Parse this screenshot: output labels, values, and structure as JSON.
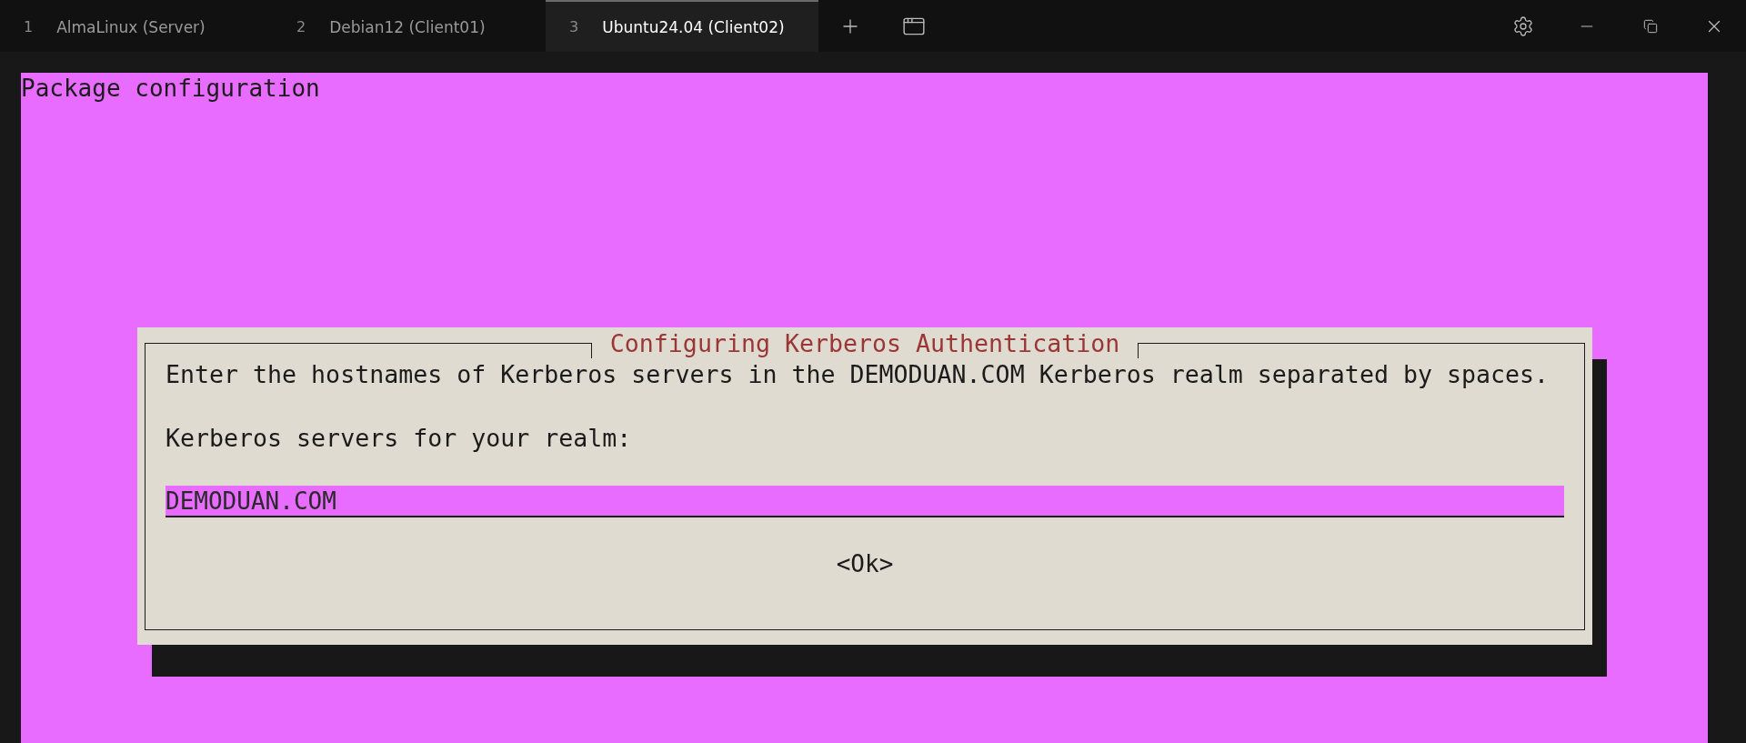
{
  "tabs": [
    {
      "number": "1",
      "label": "AlmaLinux (Server)",
      "selected": false
    },
    {
      "number": "2",
      "label": "Debian12 (Client01)",
      "selected": false
    },
    {
      "number": "3",
      "label": "Ubuntu24.04 (Client02)",
      "selected": true
    }
  ],
  "screen_title": "Package configuration",
  "dialog": {
    "title": "Configuring Kerberos Authentication",
    "message": "Enter the hostnames of Kerberos servers in the DEMODUAN.COM Kerberos realm separated by spaces.",
    "field_label": "Kerberos servers for your realm:",
    "field_value": "DEMODUAN.COM",
    "button": "<Ok>"
  }
}
